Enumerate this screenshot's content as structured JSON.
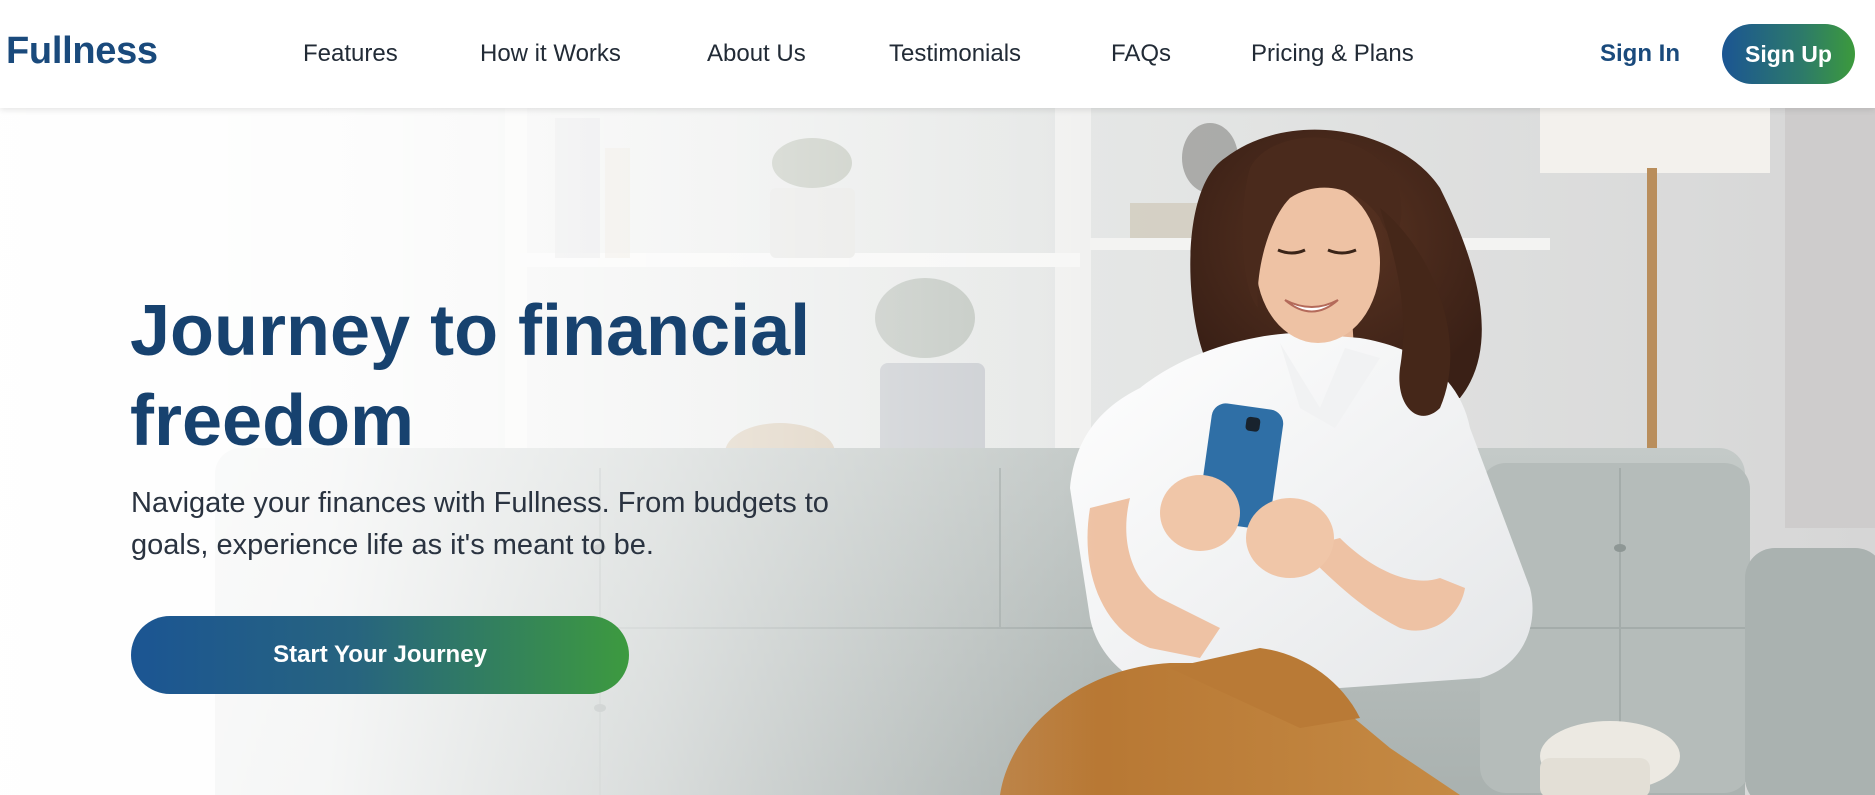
{
  "brand": {
    "logo_text": "Fullness",
    "primary": "#1a4a7c",
    "gradient_start": "#1b5593",
    "gradient_end": "#3c9a3c"
  },
  "nav": {
    "links": [
      {
        "label": "Features"
      },
      {
        "label": "How it Works"
      },
      {
        "label": "About Us"
      },
      {
        "label": "Testimonials"
      },
      {
        "label": "FAQs"
      },
      {
        "label": "Pricing & Plans"
      }
    ],
    "sign_in": "Sign In",
    "sign_up": "Sign Up"
  },
  "hero": {
    "headline": "Journey to financial freedom",
    "subheadline": "Navigate your finances with Fullness. From budgets to goals, experience life as it's meant to be.",
    "cta_label": "Start Your Journey",
    "image_subject": "woman-on-sofa-using-phone"
  }
}
